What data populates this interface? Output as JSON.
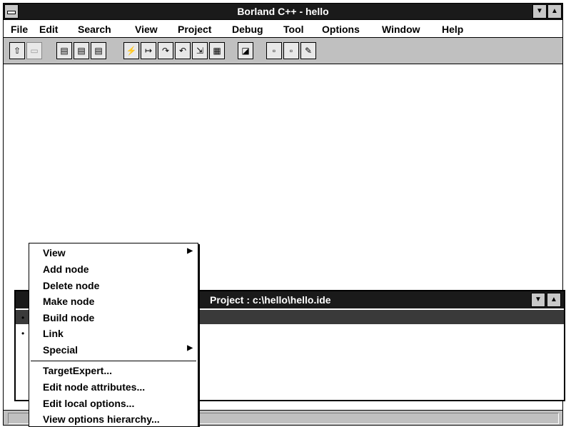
{
  "window": {
    "title": "Borland C++ - hello"
  },
  "menubar": [
    "File",
    "Edit",
    "Search",
    "View",
    "Project",
    "Debug",
    "Tool",
    "Options",
    "Window",
    "Help"
  ],
  "toolbar": [
    "open-project-icon",
    "save-project-icon",
    "compile-icon",
    "make-icon",
    "build-icon",
    "run-icon",
    "step-over-icon",
    "trace-into-icon",
    "toggle-breakpoint-icon",
    "inspect-icon",
    "find-icon",
    "new-window-icon",
    "new-file-icon",
    "new-project-icon",
    "tool-icon"
  ],
  "project_window": {
    "title": "Project : c:\\hello\\hello.ide"
  },
  "context_menu": {
    "items": [
      "View",
      "Add node",
      "Delete node",
      "Make node",
      "Build node",
      "Link",
      "Special"
    ],
    "items2": [
      "TargetExpert...",
      "Edit node attributes...",
      "Edit local options...",
      "View options hierarchy..."
    ]
  }
}
